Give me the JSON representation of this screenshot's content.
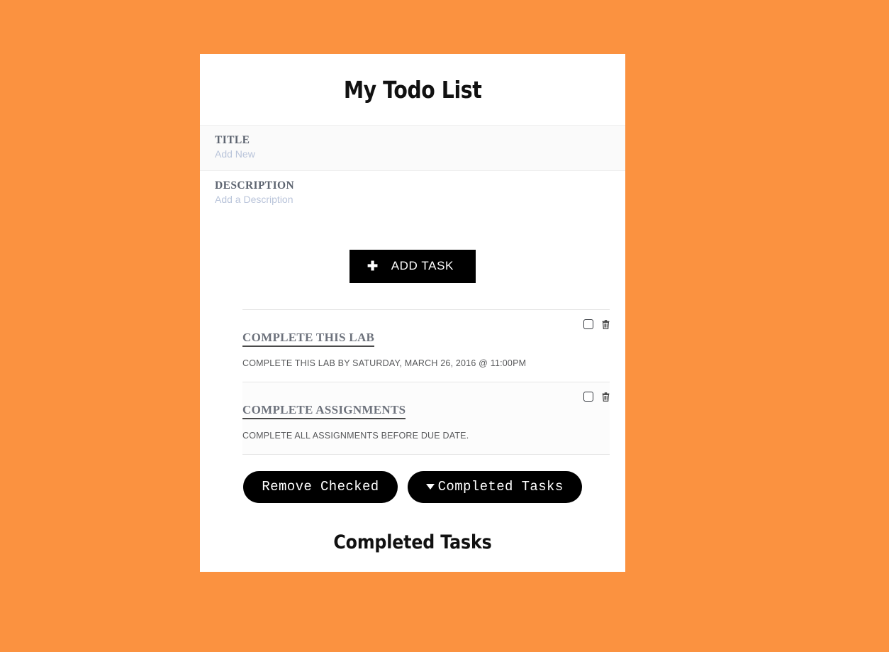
{
  "theme": {
    "background": "#fb9240",
    "card_background": "#ffffff",
    "button_background": "#000000",
    "button_text": "#ffffff",
    "label_color": "#5d6470",
    "placeholder_color": "#b9c4da"
  },
  "header": {
    "title": "My Todo List"
  },
  "form": {
    "title_field": {
      "label": "TITLE",
      "value": "",
      "placeholder": "Add New"
    },
    "description_field": {
      "label": "DESCRIPTION",
      "value": "",
      "placeholder": "Add a Description"
    },
    "add_task_button": {
      "label": "ADD TASK",
      "icon": "plus-icon"
    }
  },
  "tasks": [
    {
      "title": "COMPLETE THIS LAB",
      "description": "COMPLETE THIS LAB BY SATURDAY, MARCH 26, 2016 @ 11:00PM",
      "checked": false,
      "checkbox_name": "task-checkbox",
      "delete_icon": "trash-icon"
    },
    {
      "title": "COMPLETE ASSIGNMENTS",
      "description": "COMPLETE ALL ASSIGNMENTS BEFORE DUE DATE.",
      "checked": false,
      "checkbox_name": "task-checkbox",
      "delete_icon": "trash-icon"
    }
  ],
  "actions": {
    "remove_checked_label": "Remove Checked",
    "completed_tasks_label": "Completed Tasks",
    "completed_tasks_icon": "caret-down-icon"
  },
  "completed_section": {
    "heading": "Completed Tasks",
    "items": []
  }
}
